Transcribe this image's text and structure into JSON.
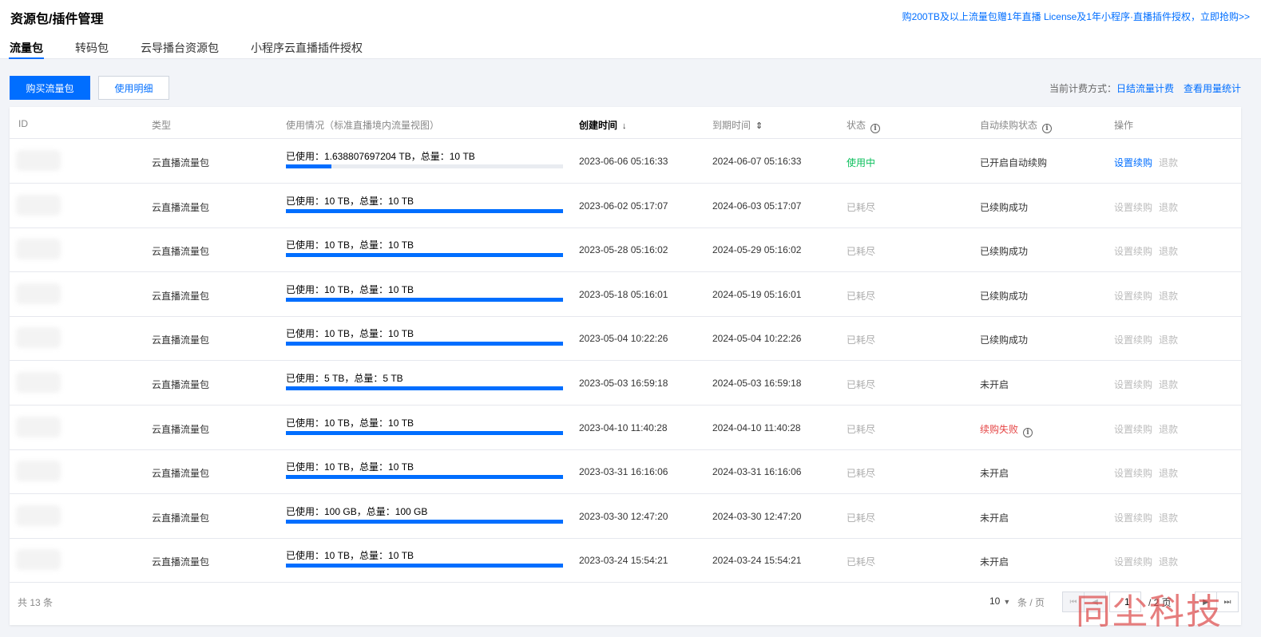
{
  "header": {
    "title": "资源包/插件管理",
    "promo": "购200TB及以上流量包赠1年直播 License及1年小程序·直播插件授权，立即抢购>>",
    "tabs": [
      "流量包",
      "转码包",
      "云导播台资源包",
      "小程序云直播插件授权"
    ],
    "active_tab": 0
  },
  "toolbar": {
    "buy_label": "购买流量包",
    "detail_label": "使用明细",
    "billing_prefix": "当前计费方式：",
    "billing_method": "日结流量计费",
    "usage_stats": "查看用量统计"
  },
  "table": {
    "columns": {
      "id": "ID",
      "type": "类型",
      "usage": "使用情况（标准直播境内流量视图）",
      "created": "创建时间",
      "expires": "到期时间",
      "status": "状态",
      "auto_renew": "自动续购状态",
      "ops": "操作"
    },
    "sort_icons": {
      "created": "↓",
      "expires": "⇕"
    },
    "info_icon": "i",
    "rows": [
      {
        "type": "云直播流量包",
        "usage": "已使用：1.638807697204 TB，总量：10 TB",
        "ratio": 0.164,
        "created": "2023-06-06 05:16:33",
        "expires": "2024-06-07 05:16:33",
        "status": "使用中",
        "status_kind": "active",
        "renew": "已开启自动续购",
        "renew_kind": "normal",
        "op1": "设置续购",
        "op2": "退款",
        "op1_enabled": true
      },
      {
        "type": "云直播流量包",
        "usage": "已使用：10 TB，总量：10 TB",
        "ratio": 1,
        "created": "2023-06-02 05:17:07",
        "expires": "2024-06-03 05:17:07",
        "status": "已耗尽",
        "status_kind": "grey",
        "renew": "已续购成功",
        "renew_kind": "normal",
        "op1": "设置续购",
        "op2": "退款",
        "op1_enabled": false
      },
      {
        "type": "云直播流量包",
        "usage": "已使用：10 TB，总量：10 TB",
        "ratio": 1,
        "created": "2023-05-28 05:16:02",
        "expires": "2024-05-29 05:16:02",
        "status": "已耗尽",
        "status_kind": "grey",
        "renew": "已续购成功",
        "renew_kind": "normal",
        "op1": "设置续购",
        "op2": "退款",
        "op1_enabled": false
      },
      {
        "type": "云直播流量包",
        "usage": "已使用：10 TB，总量：10 TB",
        "ratio": 1,
        "created": "2023-05-18 05:16:01",
        "expires": "2024-05-19 05:16:01",
        "status": "已耗尽",
        "status_kind": "grey",
        "renew": "已续购成功",
        "renew_kind": "normal",
        "op1": "设置续购",
        "op2": "退款",
        "op1_enabled": false
      },
      {
        "type": "云直播流量包",
        "usage": "已使用：10 TB，总量：10 TB",
        "ratio": 1,
        "created": "2023-05-04 10:22:26",
        "expires": "2024-05-04 10:22:26",
        "status": "已耗尽",
        "status_kind": "grey",
        "renew": "已续购成功",
        "renew_kind": "normal",
        "op1": "设置续购",
        "op2": "退款",
        "op1_enabled": false
      },
      {
        "type": "云直播流量包",
        "usage": "已使用：5 TB，总量：5 TB",
        "ratio": 1,
        "created": "2023-05-03 16:59:18",
        "expires": "2024-05-03 16:59:18",
        "status": "已耗尽",
        "status_kind": "grey",
        "renew": "未开启",
        "renew_kind": "normal",
        "op1": "设置续购",
        "op2": "退款",
        "op1_enabled": false
      },
      {
        "type": "云直播流量包",
        "usage": "已使用：10 TB，总量：10 TB",
        "ratio": 1,
        "created": "2023-04-10 11:40:28",
        "expires": "2024-04-10 11:40:28",
        "status": "已耗尽",
        "status_kind": "grey",
        "renew": "续购失败",
        "renew_kind": "fail",
        "op1": "设置续购",
        "op2": "退款",
        "op1_enabled": false
      },
      {
        "type": "云直播流量包",
        "usage": "已使用：10 TB，总量：10 TB",
        "ratio": 1,
        "created": "2023-03-31 16:16:06",
        "expires": "2024-03-31 16:16:06",
        "status": "已耗尽",
        "status_kind": "grey",
        "renew": "未开启",
        "renew_kind": "normal",
        "op1": "设置续购",
        "op2": "退款",
        "op1_enabled": false
      },
      {
        "type": "云直播流量包",
        "usage": "已使用：100 GB，总量：100 GB",
        "ratio": 1,
        "created": "2023-03-30 12:47:20",
        "expires": "2024-03-30 12:47:20",
        "status": "已耗尽",
        "status_kind": "grey",
        "renew": "未开启",
        "renew_kind": "normal",
        "op1": "设置续购",
        "op2": "退款",
        "op1_enabled": false
      },
      {
        "type": "云直播流量包",
        "usage": "已使用：10 TB，总量：10 TB",
        "ratio": 1,
        "created": "2023-03-24 15:54:21",
        "expires": "2024-03-24 15:54:21",
        "status": "已耗尽",
        "status_kind": "grey",
        "renew": "未开启",
        "renew_kind": "normal",
        "op1": "设置续购",
        "op2": "退款",
        "op1_enabled": false
      }
    ]
  },
  "footer": {
    "total": "共 13 条",
    "page_size": "10",
    "page_size_unit": "条 / 页",
    "current_page": "1",
    "total_pages": "/ 2 页"
  },
  "watermark": "同尘科技",
  "colors": {
    "accent": "#006eff",
    "active": "#0abf5b",
    "fail": "#e54545"
  }
}
